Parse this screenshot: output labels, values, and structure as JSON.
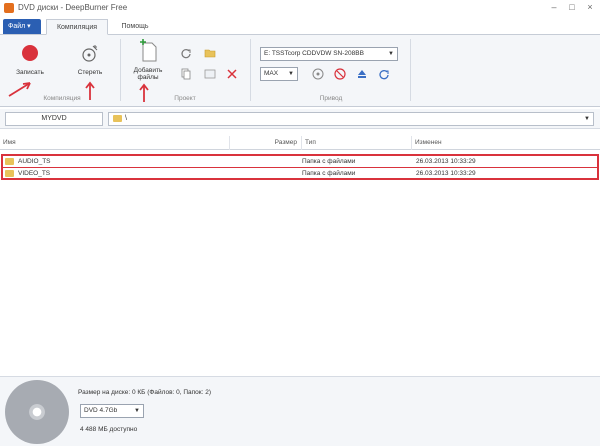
{
  "window": {
    "title": "DVD диски - DeepBurner Free",
    "controls": [
      "–",
      "□",
      "×"
    ]
  },
  "tabs": {
    "file": "Файл ▾",
    "items": [
      "Компиляция",
      "Помощь"
    ]
  },
  "ribbon": {
    "burn_label": "Записать",
    "erase_label": "Стереть",
    "add_files_label": "Добавить файлы",
    "group_compilation": "Компиляция",
    "group_project": "Проект",
    "group_device": "Привод",
    "drive_select": "E: TSSTcorp CDDVDW SN-208BB",
    "speed_select": "MAX"
  },
  "pathbar": {
    "disc_label": "MYDVD",
    "path": "\\"
  },
  "list": {
    "columns": [
      "Имя",
      "Размер",
      "Тип",
      "Изменен"
    ],
    "rows": [
      {
        "name": "AUDIO_TS",
        "size": "",
        "type": "Папка с файлами",
        "modified": "26.03.2013 10:33:29"
      },
      {
        "name": "VIDEO_TS",
        "size": "",
        "type": "Папка с файлами",
        "modified": "26.03.2013 10:33:29"
      }
    ]
  },
  "status": {
    "size_info": "Размер на диске: 0 КБ (Файлов: 0, Папок: 2)",
    "disc_type": "DVD 4.7Gb",
    "free_space": "4 488 МБ доступно"
  },
  "colors": {
    "accent_blue": "#2b5fb3",
    "record_red": "#d9323c",
    "annotation_red": "#d9323c"
  }
}
